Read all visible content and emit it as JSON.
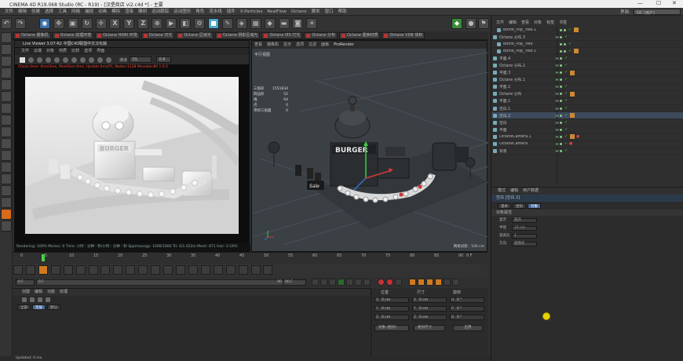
{
  "window": {
    "title": "CINEMA 4D R19.068 Studio (RC - R19) - [汉堡商店 vi2.c4d *] - 主要",
    "minimize": "—",
    "maximize": "☐",
    "close": "✕"
  },
  "menu": {
    "items": [
      "文件",
      "编辑",
      "创建",
      "选择",
      "工具",
      "网格",
      "捕捉",
      "动画",
      "模拟",
      "渲染",
      "雕刻",
      "运动跟踪",
      "运动图形",
      "角色",
      "流水线",
      "插件",
      "X-Particles",
      "RealFlow",
      "Octane",
      "脚本",
      "窗口",
      "帮助"
    ],
    "layout_label": "界面:",
    "layout_value": "OC (用户)"
  },
  "octane_tabs": [
    "Octane 摄像机",
    "Octane 纹理环境",
    "Octane HDRI 环境",
    "Octane 日光",
    "Octane 区域光",
    "Octane 阴影区域光",
    "Octane IES 灯光",
    "Octane 分布",
    "Octane 置换材质",
    "Octane VDB 体积"
  ],
  "live_viewer": {
    "title": "Live Viewer 3.07-R2 中国C4D联盟中文汉化版",
    "menu": [
      "文件",
      "云端",
      "对象",
      "材质",
      "比较",
      "选项",
      "界面"
    ],
    "channel_label": "通道",
    "channel_value": "DL",
    "channel_num": "0.6",
    "status": "Check time: 0ms/3ms, MeshGen:0ms, Update:0ms[P], Nodes:1128 Movable:80 1 0 0",
    "footer": "Rendering: 100%  Ms/sec: 0  Time: 小时 : 分钟 : 秒/小时 : 分钟 : 秒  Spp/maxspp: 1000/1000  Tri: 0/1.452m  Mesh: 871  Hair: 0    GPU:"
  },
  "viewport": {
    "menu": [
      "查看",
      "摄像机",
      "显示",
      "选项",
      "过滤",
      "面板",
      "ProRender"
    ],
    "label": "平行视图",
    "stats": [
      {
        "k": "三角形",
        "v": "1551834"
      },
      {
        "k": "四边形",
        "v": "52"
      },
      {
        "k": "线",
        "v": "64"
      },
      {
        "k": "点",
        "v": "0"
      },
      {
        "k": "带状三角面",
        "v": "0"
      }
    ],
    "grid": "网格间距 : 100 cm",
    "burger_sign": "BURGER",
    "sale_sign": "Sale"
  },
  "timeline": {
    "ticks": [
      "0",
      "5",
      "10",
      "15",
      "20",
      "25",
      "30",
      "35",
      "40",
      "45",
      "50",
      "55",
      "60",
      "65",
      "70",
      "75",
      "80",
      "85",
      "90"
    ],
    "end_frame": "0 F",
    "start_field": "0 F",
    "cur_field": "0 F",
    "max_field": "90 F",
    "max_field2": "90 F"
  },
  "material_manager": {
    "tabs": [
      "创建",
      "编辑",
      "功能",
      "纹理"
    ],
    "subtabs": [
      "全部",
      "无层",
      "默认"
    ]
  },
  "coordinates": {
    "headers": [
      "位置",
      "尺寸",
      "旋转"
    ],
    "rows": [
      {
        "axis": "X",
        "pos": "0 cm",
        "size": "0 cm",
        "rot_label": "H",
        "rot": "0 °"
      },
      {
        "axis": "Y",
        "pos": "0 cm",
        "size": "0 cm",
        "rot_label": "P",
        "rot": "0 °"
      },
      {
        "axis": "Z",
        "pos": "0 cm",
        "size": "0 cm",
        "rot_label": "B",
        "rot": "0 °"
      }
    ],
    "mode1": "对象 (相对)",
    "mode2": "绝对尺寸",
    "apply": "应用"
  },
  "status_bar": "Updated: 0 ms.",
  "object_manager": {
    "tabs": [
      "文件",
      "编辑",
      "查看",
      "对象",
      "标签",
      "书签"
    ],
    "objects": [
      {
        "name": "Bomb_Pop_Tree.1",
        "indent": 1
      },
      {
        "name": "Octane 分布.3",
        "indent": 0
      },
      {
        "name": "Bomb_Pop_Tree",
        "indent": 1
      },
      {
        "name": "Bomb_Pop_Tree.5",
        "indent": 1
      },
      {
        "name": "平面.4",
        "indent": 0
      },
      {
        "name": "Octane 分布.2",
        "indent": 0
      },
      {
        "name": "平面.3",
        "indent": 0
      },
      {
        "name": "Octane 分布.1",
        "indent": 0
      },
      {
        "name": "平面.2",
        "indent": 0
      },
      {
        "name": "Octane 分布",
        "indent": 0
      },
      {
        "name": "平面.1",
        "indent": 0
      },
      {
        "name": "空白.1",
        "indent": 0
      },
      {
        "name": "空白.2",
        "indent": 0
      },
      {
        "name": "空白",
        "indent": 0
      },
      {
        "name": "平面",
        "indent": 0
      },
      {
        "name": "OctaneCamera.1",
        "indent": 0
      },
      {
        "name": "OctaneCamera",
        "indent": 0
      },
      {
        "name": "背景",
        "indent": 0
      }
    ]
  },
  "attributes": {
    "header": [
      "模式",
      "编辑",
      "用户数据"
    ],
    "object_line": "空白 [空白.2]",
    "tabs": [
      "基本",
      "坐标",
      "对象"
    ],
    "section": "对象属性",
    "rows": [
      {
        "label": "显示",
        "value": "圆点"
      },
      {
        "label": "半径",
        "value": "10 cm"
      },
      {
        "label": "宽高比",
        "value": "1"
      },
      {
        "label": "方向",
        "value": "摄像机"
      }
    ]
  },
  "colors": {
    "accent": "#3a6fa8",
    "record": "#c83232",
    "cursor": "#e8d400",
    "timeline_marker": "#4bd14b"
  }
}
